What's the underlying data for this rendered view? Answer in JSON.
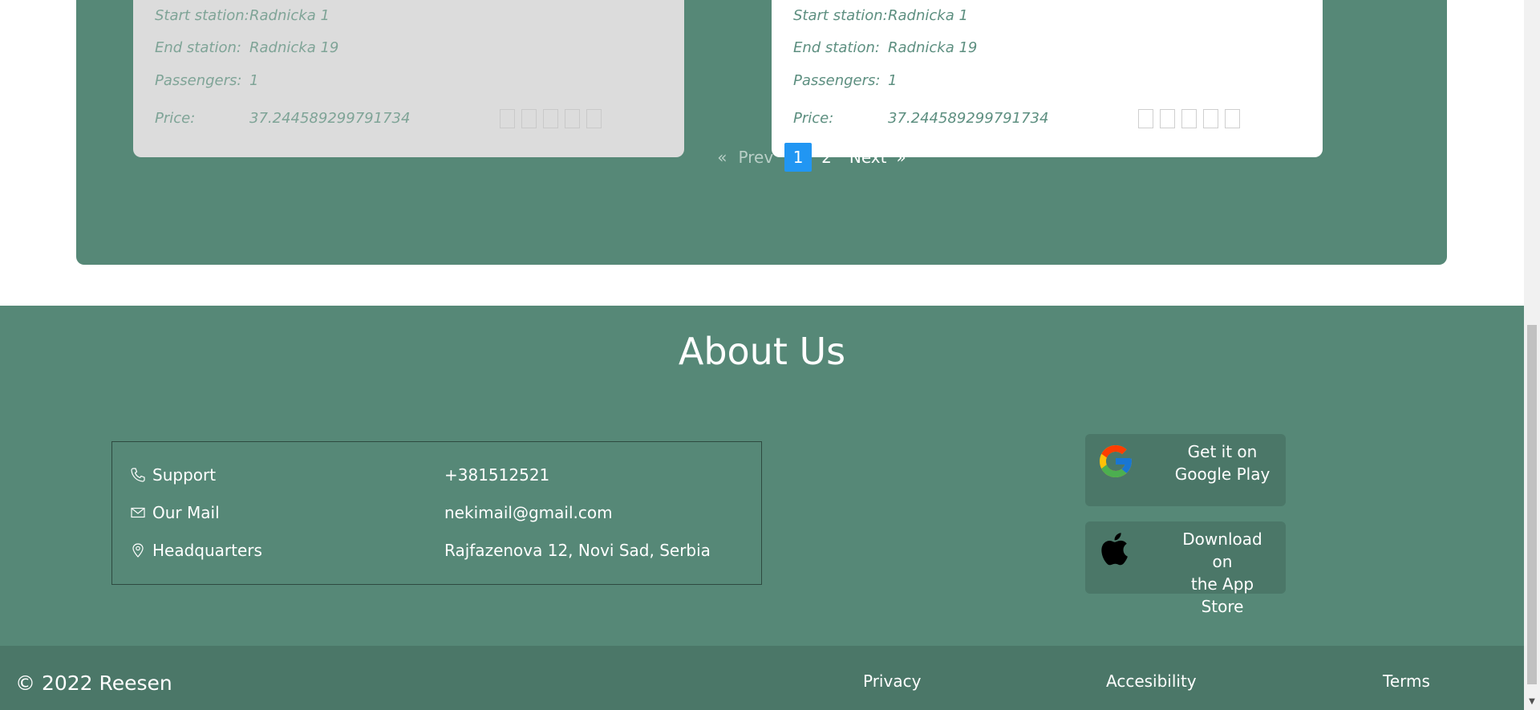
{
  "rides": [
    {
      "start_label": "Start station:",
      "start_value": "Radnicka 1",
      "end_label": "End station:",
      "end_value": "Radnicka 19",
      "passengers_label": "Passengers:",
      "passengers_value": "1",
      "price_label": "Price:",
      "price_value": "37.244589299791734",
      "rating_stars": 5
    },
    {
      "start_label": "Start station:",
      "start_value": "Radnicka 1",
      "end_label": "End station:",
      "end_value": "Radnicka 19",
      "passengers_label": "Passengers:",
      "passengers_value": "1",
      "price_label": "Price:",
      "price_value": "37.244589299791734",
      "rating_stars": 5
    }
  ],
  "pagination": {
    "first": "«",
    "prev": "Prev",
    "current": "1",
    "page2": "2",
    "next": "Next",
    "last": "»"
  },
  "about": {
    "title": "About Us",
    "support_label": "Support",
    "support_value": "+381512521",
    "mail_label": "Our Mail",
    "mail_value": "nekimail@gmail.com",
    "hq_label": "Headquarters",
    "hq_value": "Rajfazenova 12, Novi Sad, Serbia"
  },
  "stores": {
    "google_line1": "Get it on",
    "google_line2": "Google Play",
    "apple_line1": "Download on",
    "apple_line2": "the App Store"
  },
  "footer": {
    "copyright": "© 2022 Reesen",
    "privacy": "Privacy",
    "accessibility": "Accesibility",
    "terms": "Terms"
  },
  "colors": {
    "panel": "#568877",
    "footer": "#4b7768",
    "page_active": "#2196f3"
  }
}
